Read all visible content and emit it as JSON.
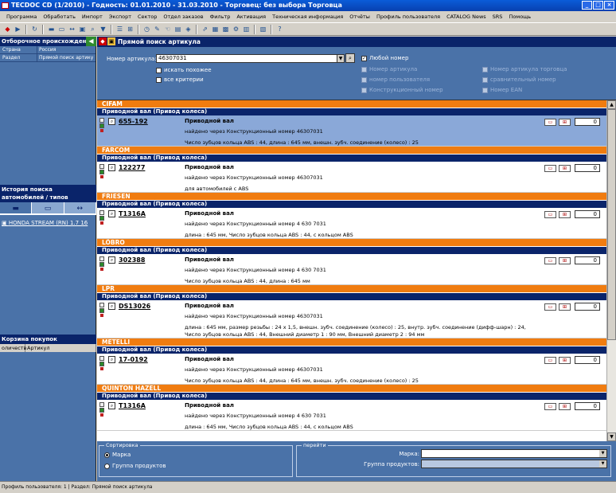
{
  "window": {
    "title": "TECDOC CD (1/2010)  -  Годность: 01.01.2010 - 31.03.2010  -  Торговец: без выбора Торговца"
  },
  "menu": [
    "Программа",
    "Обработать",
    "Импорт",
    "Экспорт",
    "Сектор",
    "Отдел заказов",
    "Фильтр",
    "Активация",
    "Техническая информация",
    "Отчёты",
    "Профиль пользователя",
    "CATALOG News",
    "SRS",
    "Помощь"
  ],
  "left": {
    "filter_title": "Отборочное происхождение",
    "rows": [
      {
        "k": "Страна",
        "v": "Россия"
      },
      {
        "k": "Раздел",
        "v": "Прямой поиск артику"
      }
    ],
    "history_title": "История поиска автомобилей / типов моделей / двигателей",
    "history_item": "HONDA STREAM (RN) 1.7 16",
    "cart_title": "Корзина покупок",
    "cart_cols": [
      "оличеств",
      "Артикул"
    ]
  },
  "main": {
    "title": "Прямой поиск артикула",
    "search": {
      "label": "Номер артикула:",
      "value": "46307031",
      "cb_similar": "искать похожее",
      "cb_all": "все критерии",
      "cb_any": "Любой номер",
      "cb_art": "Номер артикула",
      "cb_user": "номер пользователя",
      "cb_constr": "Конструкционный номер",
      "cb_trade": "Номер артикула торговца",
      "cb_compare": "сравнительный номер",
      "cb_ean": "Номер EAN"
    },
    "results": [
      {
        "brand": "CIFAM",
        "group": "Приводной вал (Привод колеса)",
        "art": "655-192",
        "name": "Приводной вал",
        "found": "найдено через Конструкционный номер 46307031",
        "crit": "Число зубцов кольца ABS : 44, длина : 645 мм, внешн. зубч. соединение (колесо) : 25",
        "qty": "0",
        "sel": true
      },
      {
        "brand": "FARCOM",
        "group": "Приводной вал (Привод колеса)",
        "art": "122277",
        "name": "Приводной вал",
        "found": "найдено через Конструкционный номер 46307031",
        "crit": "для автомобилей с ABS",
        "qty": "0"
      },
      {
        "brand": "FRIESEN",
        "group": "Приводной вал (Привод колеса)",
        "art": "T1316A",
        "name": "Приводной вал",
        "found": "найдено через Конструкционный номер 4 630 7031",
        "crit": "длина : 645 мм, Число зубцов кольца ABS : 44, с кольцом ABS",
        "qty": "0"
      },
      {
        "brand": "LÖBRO",
        "group": "Приводной вал (Привод колеса)",
        "art": "302388",
        "name": "Приводной вал",
        "found": "найдено через Конструкционный номер 4 630 7031",
        "crit": "Число зубцов кольца ABS : 44, длина : 645 мм",
        "qty": "0"
      },
      {
        "brand": "LPR",
        "group": "Приводной вал (Привод колеса)",
        "art": "DS13026",
        "name": "Приводной вал",
        "found": "найдено через Конструкционный номер 46307031",
        "crit": "длина : 645 мм, размер резьбы : 24 х 1,5, внешн. зубч. соединение (колесо) : 25, внутр. зубч. соединение (дифф-шарн) : 24, Число зубцов кольца ABS : 44, Внешний диаметр 1 : 90 мм, Внешний диаметр 2 : 94 мм",
        "qty": "0",
        "tall": true
      },
      {
        "brand": "METELLI",
        "group": "Приводной вал (Привод колеса)",
        "art": "17-0192",
        "name": "Приводной вал",
        "found": "найдено через Конструкционный номер 46307031",
        "crit": "Число зубцов кольца ABS : 44, длина : 645 мм, внешн. зубч. соединение (колесо) : 25",
        "qty": "0"
      },
      {
        "brand": "QUINTON HAZELL",
        "group": "Приводной вал (Привод колеса)",
        "art": "T1316A",
        "name": "Приводной вал",
        "found": "найдено через Конструкционный номер 4 630 7031",
        "crit": "длина : 645 мм, Число зубцов кольца ABS : 44, с кольцом ABS",
        "qty": "0"
      }
    ],
    "sort": {
      "legend": "Сортировка",
      "opt1": "Марка",
      "opt2": "Группа продуктов"
    },
    "goto": {
      "legend": "перейти",
      "brand": "Марка:",
      "group": "Группа продуктов:"
    }
  },
  "status": "Профиль пользователя: 1 | Раздел: Прямой поиск артикула"
}
